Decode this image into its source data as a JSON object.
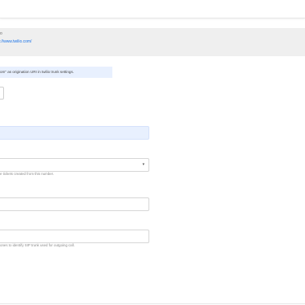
{
  "banner": {
    "title": "o",
    "url": "://www.twilio.com/"
  },
  "note": {
    "text": "om\" as origination URI in twilio trunk settings."
  },
  "select": {
    "caret_icon": "▾"
  },
  "help_texts": {
    "tickets": "e tickets created from this number.",
    "outgoing": "ones to identify SIP trunk used for outgoing call."
  }
}
